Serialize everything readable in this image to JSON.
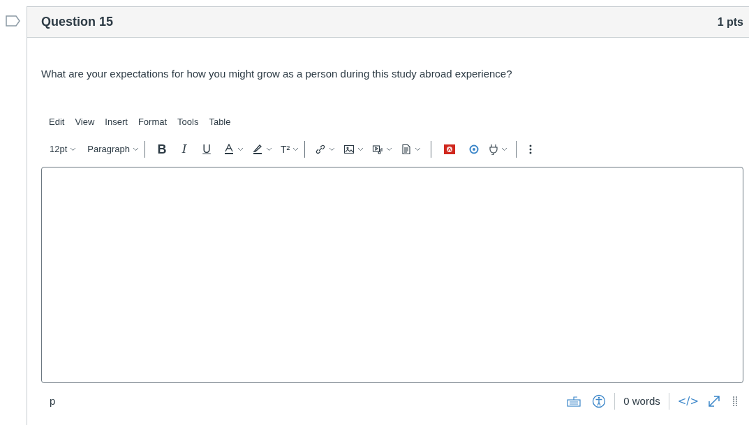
{
  "question": {
    "title": "Question 15",
    "points": "1 pts",
    "text": "What are your expectations for how you might grow as a person during this study abroad experience?"
  },
  "editor": {
    "menu": [
      "Edit",
      "View",
      "Insert",
      "Format",
      "Tools",
      "Table"
    ],
    "font_size": "12pt",
    "block_format": "Paragraph",
    "format_buttons": [
      "B",
      "I",
      "U"
    ],
    "superscript": "T²",
    "status": {
      "path": "p",
      "word_count": "0 words",
      "html_toggle": "</>"
    }
  }
}
